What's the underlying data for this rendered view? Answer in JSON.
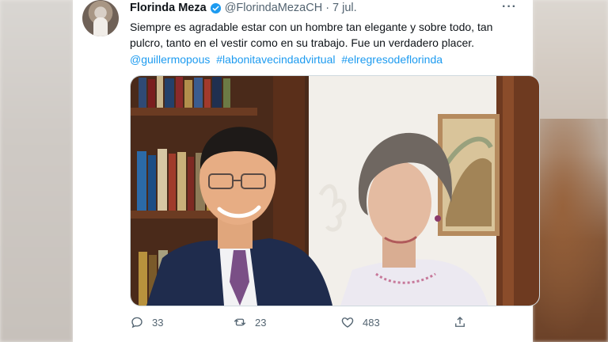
{
  "tweet": {
    "author_name": "Florinda Meza",
    "handle": "@FlorindaMezaCH",
    "separator": "·",
    "date": "7 jul.",
    "more": "···",
    "text_line1": "Siempre es agradable estar con un hombre tan elegante y sobre todo, tan",
    "text_line2": "pulcro, tanto en el vestir como en su trabajo. Fue un verdadero placer.",
    "hashtags": [
      "@guillermopous",
      "#labonitavecindadvirtual",
      "#elregresodeflorinda"
    ],
    "replies": "33",
    "retweets": "23",
    "likes": "483"
  },
  "colors": {
    "link": "#1d9bf0",
    "muted": "#536471",
    "text": "#0f1419",
    "verified": "#1d9bf0"
  },
  "icons": {
    "verified": "verified-badge-icon",
    "reply": "reply-icon",
    "retweet": "retweet-icon",
    "like": "like-icon",
    "share": "share-icon"
  }
}
